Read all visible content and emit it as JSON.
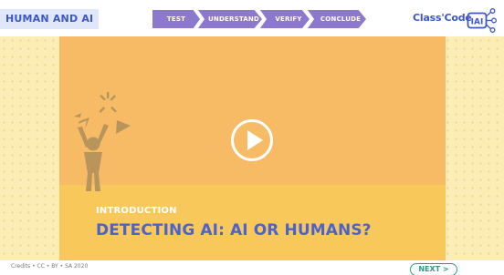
{
  "header": {
    "course_title": "HUMAN AND AI",
    "steps": [
      {
        "label": "TEST"
      },
      {
        "label": "UNDERSTAND"
      },
      {
        "label": "VERIFY"
      },
      {
        "label": "CONCLUDE"
      }
    ],
    "brand": {
      "name": "Class'Code",
      "logo_text": "IAI",
      "logo_icon": "network-icon"
    }
  },
  "video": {
    "section_label": "INTRODUCTION",
    "title": "DETECTING AI: AI OR HUMANS?",
    "play_icon": "play-icon",
    "illustration": "frustrated-person-icon"
  },
  "footer": {
    "credits": "Credits • CC • BY • SA 2020",
    "next_label": "NEXT >"
  },
  "colors": {
    "brand_blue": "#3d57c6",
    "step_purple": "#8c78cf",
    "card_orange": "#f7bb66",
    "card_yellow": "#f8c95a",
    "next_green": "#2e9a86"
  }
}
